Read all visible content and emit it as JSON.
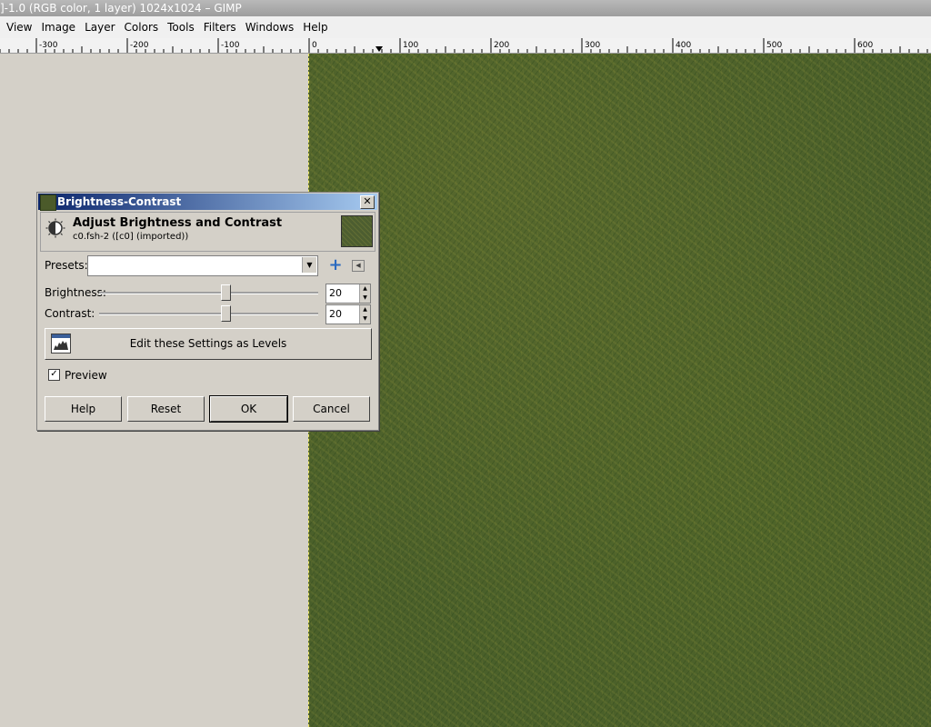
{
  "window": {
    "title": "]-1.0 (RGB color, 1 layer) 1024x1024 – GIMP"
  },
  "menu": [
    {
      "label": "View"
    },
    {
      "label": "Image"
    },
    {
      "label": "Layer"
    },
    {
      "label": "Colors"
    },
    {
      "label": "Tools"
    },
    {
      "label": "Filters"
    },
    {
      "label": "Windows"
    },
    {
      "label": "Help"
    }
  ],
  "ruler": {
    "labels": [
      "-300",
      "-200",
      "-100",
      "0",
      "100",
      "200",
      "300",
      "400",
      "500",
      "600"
    ]
  },
  "dialog": {
    "title": "Brightness-Contrast",
    "close": "✕",
    "header_title": "Adjust Brightness and Contrast",
    "header_subtitle": "c0.fsh-2 ([c0] (imported))",
    "presets_label": "Presets:",
    "presets_value": "",
    "brightness_label": "Brightness:",
    "brightness_value": "20",
    "contrast_label": "Contrast:",
    "contrast_value": "20",
    "levels_button": "Edit these Settings as Levels",
    "preview_label": "Preview",
    "preview_checked": true,
    "buttons": {
      "help": "Help",
      "reset": "Reset",
      "ok": "OK",
      "cancel": "Cancel"
    }
  },
  "colors": {
    "title_bar_start": "#0a246a",
    "title_bar_end": "#a6caf0",
    "image_green": "#4a5f2a"
  }
}
